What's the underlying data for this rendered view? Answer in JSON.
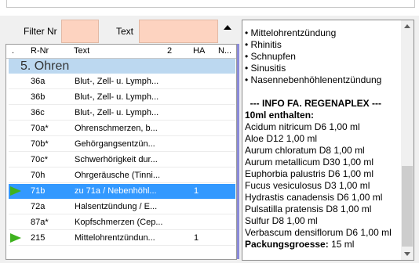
{
  "filters": {
    "filter_nr_label": "Filter Nr",
    "filter_nr_value": "",
    "text_label": "Text",
    "text_value": ""
  },
  "grid": {
    "columns": [
      ".",
      "R-Nr",
      "Text",
      "2",
      "HA",
      "N..."
    ],
    "group_label": "5. Ohren",
    "rows": [
      {
        "rnr": "36a",
        "text": "Blut-, Zell- u. Lymph...",
        "ha": "",
        "selected": false,
        "indicator": false
      },
      {
        "rnr": "36b",
        "text": "Blut-, Zell- u. Lymph...",
        "ha": "",
        "selected": false,
        "indicator": false
      },
      {
        "rnr": "36c",
        "text": "Blut-, Zell- u. Lymph...",
        "ha": "",
        "selected": false,
        "indicator": false
      },
      {
        "rnr": "70a*",
        "text": "Ohrenschmerzen, b...",
        "ha": "",
        "selected": false,
        "indicator": false
      },
      {
        "rnr": "70b*",
        "text": "Gehörgangsentzün...",
        "ha": "",
        "selected": false,
        "indicator": false
      },
      {
        "rnr": "70c*",
        "text": "Schwerhörigkeit dur...",
        "ha": "",
        "selected": false,
        "indicator": false
      },
      {
        "rnr": "70h",
        "text": "Ohrgeräusche (Tinni...",
        "ha": "",
        "selected": false,
        "indicator": false
      },
      {
        "rnr": "71b",
        "text": "zu 71a / Nebenhöhl...",
        "ha": "1",
        "selected": true,
        "indicator": true
      },
      {
        "rnr": "72a",
        "text": "Halsentzündung / E...",
        "ha": "",
        "selected": false,
        "indicator": false
      },
      {
        "rnr": "87a*",
        "text": "Kopfschmerzen (Cep...",
        "ha": "",
        "selected": false,
        "indicator": false
      },
      {
        "rnr": "215",
        "text": "Mittelohrentzündun...",
        "ha": "1",
        "selected": false,
        "indicator": true
      }
    ]
  },
  "detail": {
    "lines": [
      {
        "text": "• Mittelohrentzündung",
        "bold": false
      },
      {
        "text": "• Rhinitis",
        "bold": false
      },
      {
        "text": "• Schnupfen",
        "bold": false
      },
      {
        "text": "• Sinusitis",
        "bold": false
      },
      {
        "text": "• Nasennebenhöhlenentzündung",
        "bold": false
      },
      {
        "text": "",
        "bold": false
      },
      {
        "text": "  --- INFO FA. REGENAPLEX ---",
        "bold": true
      },
      {
        "text": "10ml enthalten:",
        "bold": true
      },
      {
        "text": "Acidum nitricum D6 1,00 ml",
        "bold": false
      },
      {
        "text": "Aloe D12 1,00 ml",
        "bold": false
      },
      {
        "text": "Aurum chloratum D8 1,00 ml",
        "bold": false
      },
      {
        "text": "Aurum metallicum D30 1,00 ml",
        "bold": false
      },
      {
        "text": "Euphorbia palustris D6 1,00 ml",
        "bold": false
      },
      {
        "text": "Fucus vesiculosus D3 1,00 ml",
        "bold": false
      },
      {
        "text": "Hydrastis canadensis D6 1,00 ml",
        "bold": false
      },
      {
        "text": "Pulsatilla pratensis D8 1,00 ml",
        "bold": false
      },
      {
        "text": "Sulfur D8 1,00 ml",
        "bold": false
      },
      {
        "text": "Verbascum densiflorum D6 1,00 ml",
        "bold": false
      }
    ],
    "footer_label": "Packungsgroesse:",
    "footer_value": "15 ml"
  },
  "colors": {
    "filter_field": "#fdd3c0",
    "selection": "#3399ff",
    "group_header": "#bcd8f0",
    "indicator": "#3fb21f"
  }
}
